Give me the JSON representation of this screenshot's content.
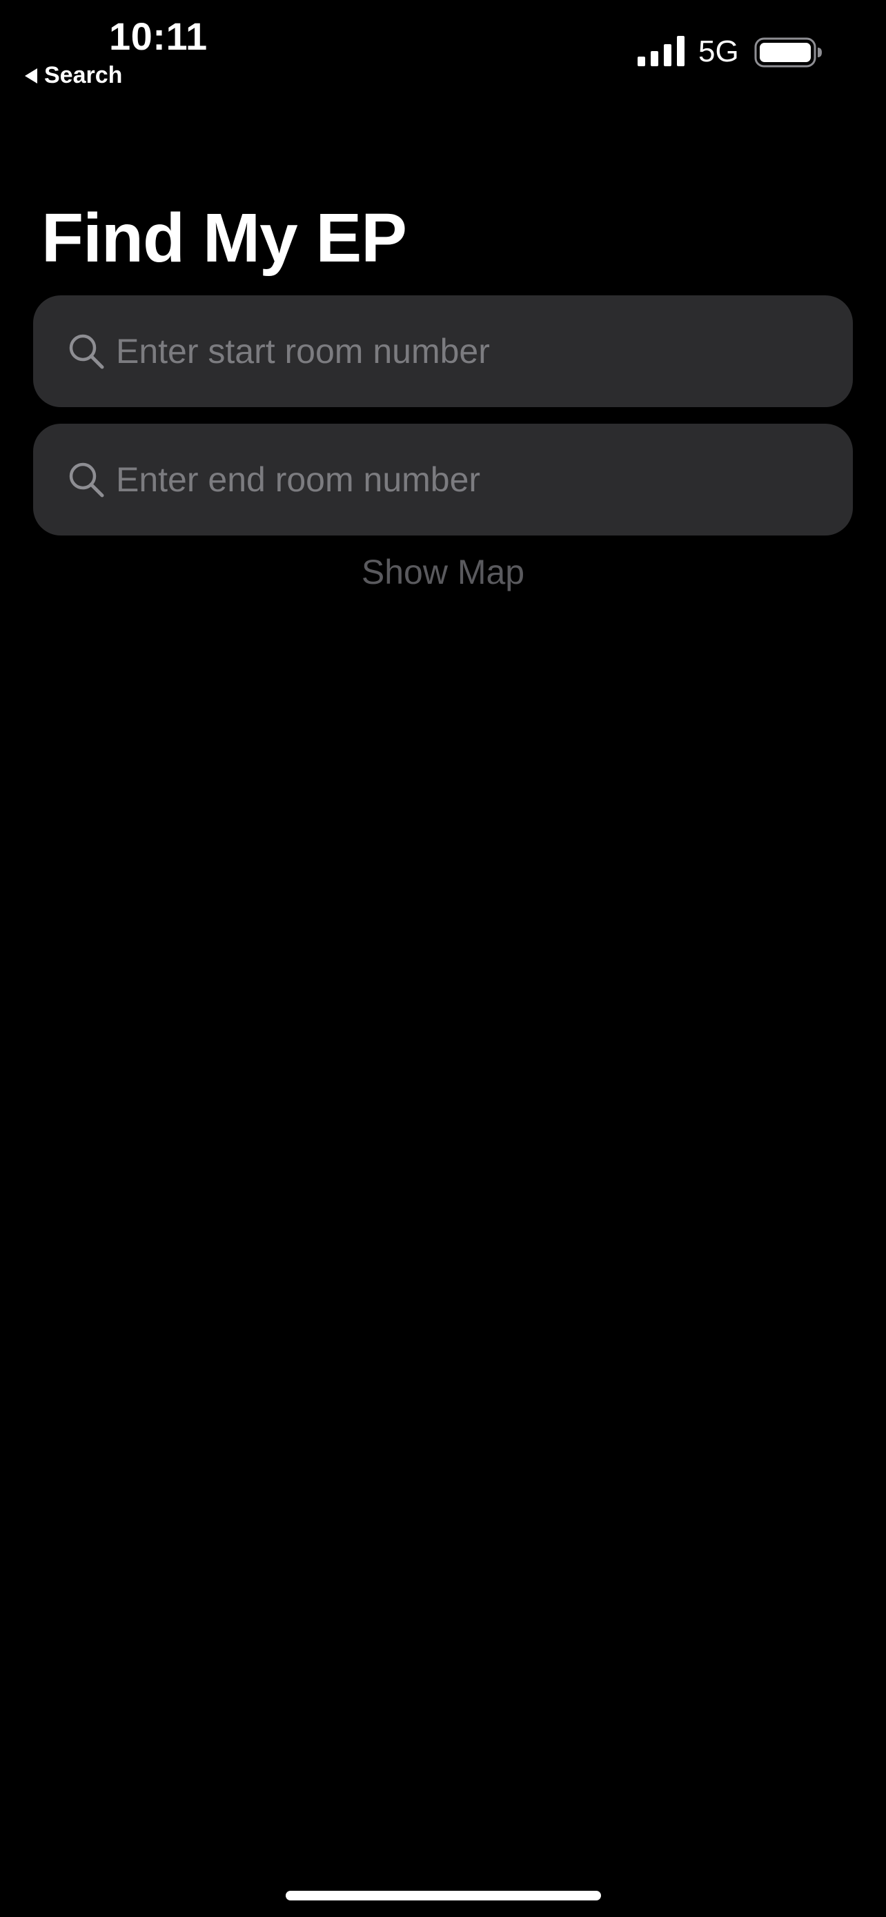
{
  "status_bar": {
    "time": "10:11",
    "back_label": "Search",
    "network": "5G",
    "signal_icon": "cellular-signal-icon",
    "battery_icon": "battery-full-icon"
  },
  "header": {
    "title": "Find My EP"
  },
  "search": {
    "start": {
      "placeholder": "Enter start room number",
      "value": "",
      "icon": "search-icon"
    },
    "end": {
      "placeholder": "Enter end room number",
      "value": "",
      "icon": "search-icon"
    }
  },
  "actions": {
    "show_map_label": "Show Map"
  },
  "colors": {
    "background": "#000000",
    "field_background": "#2c2c2e",
    "placeholder": "#7c7c80",
    "disabled_button_text": "#5a5a5e",
    "text": "#ffffff"
  }
}
